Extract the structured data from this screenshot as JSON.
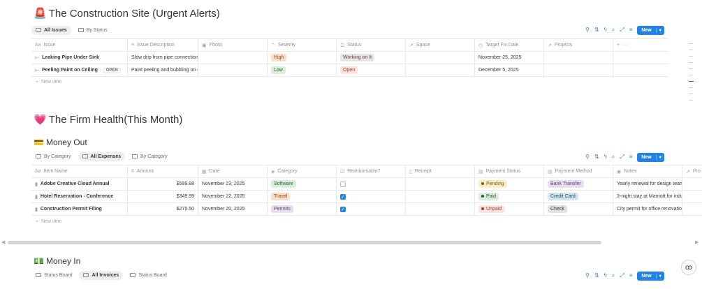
{
  "site": {
    "emoji": "🚨",
    "title": "The Construction Site (Urgent Alerts)",
    "tabs": [
      {
        "label": "All Issues",
        "active": true
      },
      {
        "label": "By Status",
        "active": false
      }
    ],
    "new_label": "New",
    "columns": [
      "Issue",
      "Issue Description",
      "Photo",
      "Severity",
      "Status",
      "Space",
      "Target Fix Date",
      "Projects"
    ],
    "rows": [
      {
        "issue": "Leaking Pipe Under Sink",
        "description": "Slow drip from pipe connection",
        "severity": "High",
        "status": "Working on It",
        "date": "November 25, 2025"
      },
      {
        "issue": "Peeling Paint on Ceiling",
        "description": "Paint peeling and bubbling on c",
        "severity": "Low",
        "status": "Open",
        "date": "December 5, 2025",
        "open_label": "OPEN"
      }
    ],
    "new_item": "New item"
  },
  "health": {
    "emoji": "💗",
    "title": "The Firm Health(This Month)"
  },
  "money_out": {
    "emoji": "💳",
    "title": "Money Out",
    "tabs": [
      {
        "label": "By Category",
        "active": false
      },
      {
        "label": "All Expenses",
        "active": true
      },
      {
        "label": "By Category",
        "active": false
      }
    ],
    "new_label": "New",
    "columns": [
      "Item Name",
      "Amount",
      "Date",
      "Category",
      "Reimbursable?",
      "Receipt",
      "Payment Status",
      "Payment Method",
      "Notes",
      "Pro"
    ],
    "rows": [
      {
        "name": "Adobe Creative Cloud Annual",
        "amount": "$599.88",
        "date": "November 23, 2025",
        "category": "Software",
        "reimbursable": false,
        "payment_status": "Pending",
        "method": "Bank Transfer",
        "notes": "Yearly renewal for design team c"
      },
      {
        "name": "Hotel Reservation - Conference",
        "amount": "$349.99",
        "date": "November 22, 2025",
        "category": "Travel",
        "reimbursable": true,
        "payment_status": "Paid",
        "method": "Credit Card",
        "notes": "3-night stay at Marriott for indu"
      },
      {
        "name": "Construction Permit Filing",
        "amount": "$275.50",
        "date": "November 20, 2025",
        "category": "Permits",
        "reimbursable": true,
        "payment_status": "Unpaid",
        "method": "Check",
        "notes": "City permit for office renovatio"
      }
    ],
    "new_item": "New item"
  },
  "money_in": {
    "emoji": "💵",
    "title": "Money In",
    "tabs": [
      {
        "label": "Status Board",
        "active": false
      },
      {
        "label": "All Invoices",
        "active": true
      },
      {
        "label": "Status Board",
        "active": false
      }
    ],
    "new_label": "New"
  },
  "colors": {
    "accent": "#2383e2",
    "high_bg": "#fadec9",
    "high_fg": "#8a4a1e",
    "low_bg": "#dbeddb",
    "low_fg": "#2b593f",
    "working_bg": "#e9e5e3",
    "working_fg": "#5a4a3f",
    "open_bg": "#ffe2dd",
    "open_fg": "#9f3a2e",
    "software_bg": "#dbeddb",
    "software_fg": "#2b593f",
    "travel_bg": "#fadec9",
    "travel_fg": "#8a4a1e",
    "permits_bg": "#e8deee",
    "permits_fg": "#5a3d73",
    "pending_bg": "#fdecc8",
    "pending_fg": "#7a5b14",
    "paid_bg": "#dbeddb",
    "paid_fg": "#2b593f",
    "unpaid_bg": "#ffe2dd",
    "unpaid_fg": "#9f3a2e",
    "bank_bg": "#e8deee",
    "bank_fg": "#5a3d73",
    "card_bg": "#d3e5ef",
    "card_fg": "#1f4a63",
    "check_bg": "#e3e2e0",
    "check_fg": "#37352f"
  }
}
